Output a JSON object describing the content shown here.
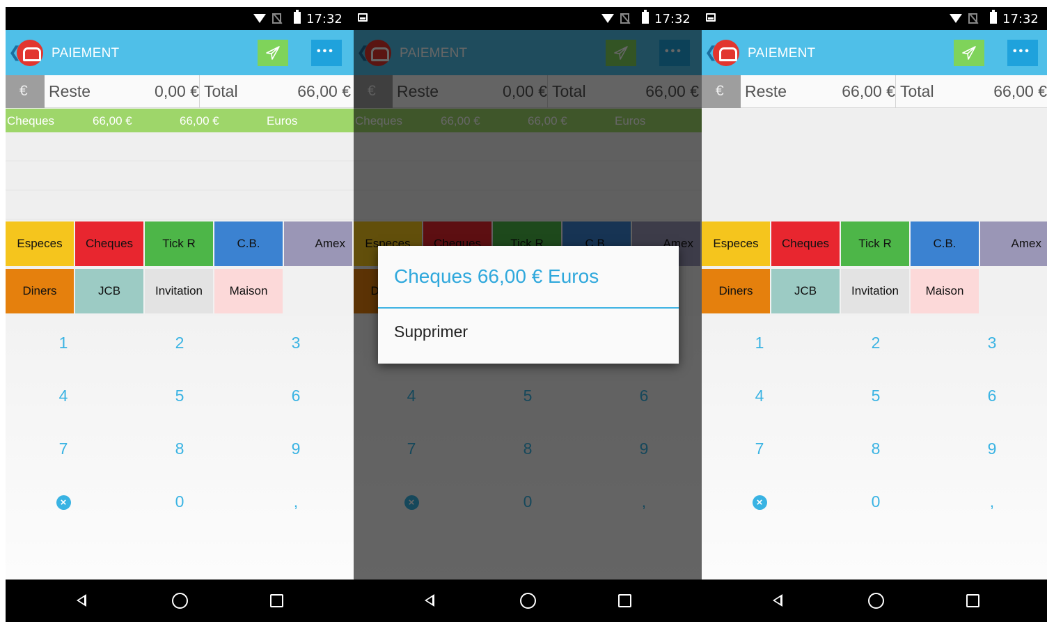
{
  "statusbar": {
    "time": "17:32"
  },
  "appbar": {
    "title": "PAIEMENT"
  },
  "totals_main": {
    "currency_symbol": "€",
    "reste_label": "Reste",
    "reste_value": "0,00 €",
    "total_label": "Total",
    "total_value": "66,00 €"
  },
  "totals_after": {
    "currency_symbol": "€",
    "reste_label": "Reste",
    "reste_value": "66,00 €",
    "total_label": "Total",
    "total_value": "66,00 €"
  },
  "payment_line": {
    "method": "Cheques",
    "amount": "66,00 €",
    "amount2": "66,00 €",
    "currency": "Euros"
  },
  "methods": [
    "Especes",
    "Cheques",
    "Tick R",
    "C.B.",
    "Amex",
    "Diners",
    "JCB",
    "Invitation",
    "Maison"
  ],
  "method_colors": [
    "#f5c51d",
    "#e8262f",
    "#4db648",
    "#3b82d1",
    "#9a96b6",
    "#e5800d",
    "#9ccbc4",
    "#e3e3e3",
    "#fcd9d9"
  ],
  "keypad": [
    "1",
    "2",
    "3",
    "4",
    "5",
    "6",
    "7",
    "8",
    "9",
    "0",
    ","
  ],
  "dialog": {
    "title": "Cheques 66,00 € Euros",
    "item": "Supprimer"
  },
  "colors": {
    "appbar": "#4fbfe8",
    "accent": "#39b3e3",
    "send": "#7fd35a",
    "more": "#1fa2dc",
    "payment_line": "#9ed66a",
    "logo": "#e2362f"
  },
  "icons": {
    "status": [
      "image-icon",
      "wifi-icon",
      "no-sim-icon",
      "battery-icon"
    ],
    "appbar": [
      "back-chevron-icon",
      "app-logo-icon",
      "send-icon",
      "more-icon"
    ],
    "keypad": "delete-icon",
    "nav": [
      "nav-back-icon",
      "nav-home-icon",
      "nav-recent-icon"
    ]
  }
}
